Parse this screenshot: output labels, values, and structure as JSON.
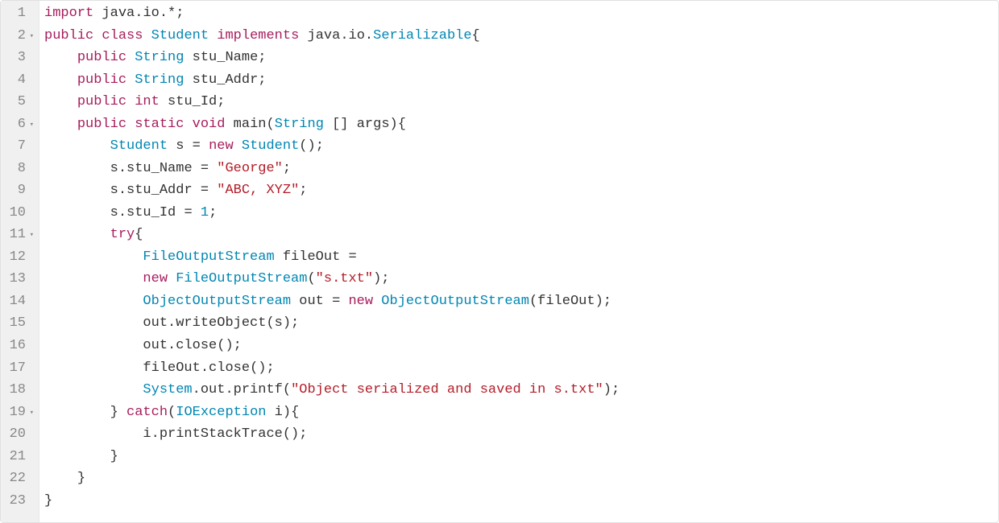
{
  "editor": {
    "language": "java",
    "fold_marker": "▾",
    "lines": [
      {
        "num": 1,
        "foldable": false,
        "tokens": [
          {
            "t": "import",
            "c": "kw"
          },
          {
            "t": " ",
            "c": "ws"
          },
          {
            "t": "java",
            "c": "pkg"
          },
          {
            "t": ".",
            "c": "punc"
          },
          {
            "t": "io",
            "c": "pkg"
          },
          {
            "t": ".*;",
            "c": "punc"
          }
        ]
      },
      {
        "num": 2,
        "foldable": true,
        "tokens": [
          {
            "t": "public",
            "c": "kw"
          },
          {
            "t": " ",
            "c": "ws"
          },
          {
            "t": "class",
            "c": "kw"
          },
          {
            "t": " ",
            "c": "ws"
          },
          {
            "t": "Student",
            "c": "type"
          },
          {
            "t": " ",
            "c": "ws"
          },
          {
            "t": "implements",
            "c": "kw"
          },
          {
            "t": " ",
            "c": "ws"
          },
          {
            "t": "java",
            "c": "pkg"
          },
          {
            "t": ".",
            "c": "punc"
          },
          {
            "t": "io",
            "c": "pkg"
          },
          {
            "t": ".",
            "c": "punc"
          },
          {
            "t": "Serializable",
            "c": "type"
          },
          {
            "t": "{",
            "c": "punc"
          }
        ]
      },
      {
        "num": 3,
        "foldable": false,
        "tokens": [
          {
            "t": "    ",
            "c": "ws"
          },
          {
            "t": "public",
            "c": "kw"
          },
          {
            "t": " ",
            "c": "ws"
          },
          {
            "t": "String",
            "c": "type"
          },
          {
            "t": " ",
            "c": "ws"
          },
          {
            "t": "stu_Name",
            "c": "ident"
          },
          {
            "t": ";",
            "c": "punc"
          }
        ]
      },
      {
        "num": 4,
        "foldable": false,
        "tokens": [
          {
            "t": "    ",
            "c": "ws"
          },
          {
            "t": "public",
            "c": "kw"
          },
          {
            "t": " ",
            "c": "ws"
          },
          {
            "t": "String",
            "c": "type"
          },
          {
            "t": " ",
            "c": "ws"
          },
          {
            "t": "stu_Addr",
            "c": "ident"
          },
          {
            "t": ";",
            "c": "punc"
          }
        ]
      },
      {
        "num": 5,
        "foldable": false,
        "tokens": [
          {
            "t": "    ",
            "c": "ws"
          },
          {
            "t": "public",
            "c": "kw"
          },
          {
            "t": " ",
            "c": "ws"
          },
          {
            "t": "int",
            "c": "kw"
          },
          {
            "t": " ",
            "c": "ws"
          },
          {
            "t": "stu_Id",
            "c": "ident"
          },
          {
            "t": ";",
            "c": "punc"
          }
        ]
      },
      {
        "num": 6,
        "foldable": true,
        "tokens": [
          {
            "t": "    ",
            "c": "ws"
          },
          {
            "t": "public",
            "c": "kw"
          },
          {
            "t": " ",
            "c": "ws"
          },
          {
            "t": "static",
            "c": "kw"
          },
          {
            "t": " ",
            "c": "ws"
          },
          {
            "t": "void",
            "c": "kw"
          },
          {
            "t": " ",
            "c": "ws"
          },
          {
            "t": "main",
            "c": "meth"
          },
          {
            "t": "(",
            "c": "punc"
          },
          {
            "t": "String",
            "c": "type"
          },
          {
            "t": " [] ",
            "c": "punc"
          },
          {
            "t": "args",
            "c": "ident"
          },
          {
            "t": "){",
            "c": "punc"
          }
        ]
      },
      {
        "num": 7,
        "foldable": false,
        "tokens": [
          {
            "t": "        ",
            "c": "ws"
          },
          {
            "t": "Student",
            "c": "type"
          },
          {
            "t": " ",
            "c": "ws"
          },
          {
            "t": "s",
            "c": "ident"
          },
          {
            "t": " = ",
            "c": "punc"
          },
          {
            "t": "new",
            "c": "kw"
          },
          {
            "t": " ",
            "c": "ws"
          },
          {
            "t": "Student",
            "c": "type"
          },
          {
            "t": "();",
            "c": "punc"
          }
        ]
      },
      {
        "num": 8,
        "foldable": false,
        "tokens": [
          {
            "t": "        ",
            "c": "ws"
          },
          {
            "t": "s",
            "c": "ident"
          },
          {
            "t": ".",
            "c": "punc"
          },
          {
            "t": "stu_Name",
            "c": "ident"
          },
          {
            "t": " = ",
            "c": "punc"
          },
          {
            "t": "\"George\"",
            "c": "str"
          },
          {
            "t": ";",
            "c": "punc"
          }
        ]
      },
      {
        "num": 9,
        "foldable": false,
        "tokens": [
          {
            "t": "        ",
            "c": "ws"
          },
          {
            "t": "s",
            "c": "ident"
          },
          {
            "t": ".",
            "c": "punc"
          },
          {
            "t": "stu_Addr",
            "c": "ident"
          },
          {
            "t": " = ",
            "c": "punc"
          },
          {
            "t": "\"ABC, XYZ\"",
            "c": "str"
          },
          {
            "t": ";",
            "c": "punc"
          }
        ]
      },
      {
        "num": 10,
        "foldable": false,
        "tokens": [
          {
            "t": "        ",
            "c": "ws"
          },
          {
            "t": "s",
            "c": "ident"
          },
          {
            "t": ".",
            "c": "punc"
          },
          {
            "t": "stu_Id",
            "c": "ident"
          },
          {
            "t": " = ",
            "c": "punc"
          },
          {
            "t": "1",
            "c": "num"
          },
          {
            "t": ";",
            "c": "punc"
          }
        ]
      },
      {
        "num": 11,
        "foldable": true,
        "tokens": [
          {
            "t": "        ",
            "c": "ws"
          },
          {
            "t": "try",
            "c": "kw"
          },
          {
            "t": "{",
            "c": "punc"
          }
        ]
      },
      {
        "num": 12,
        "foldable": false,
        "tokens": [
          {
            "t": "            ",
            "c": "ws"
          },
          {
            "t": "FileOutputStream",
            "c": "type"
          },
          {
            "t": " ",
            "c": "ws"
          },
          {
            "t": "fileOut",
            "c": "ident"
          },
          {
            "t": " =",
            "c": "punc"
          }
        ]
      },
      {
        "num": 13,
        "foldable": false,
        "tokens": [
          {
            "t": "            ",
            "c": "ws"
          },
          {
            "t": "new",
            "c": "kw"
          },
          {
            "t": " ",
            "c": "ws"
          },
          {
            "t": "FileOutputStream",
            "c": "type"
          },
          {
            "t": "(",
            "c": "punc"
          },
          {
            "t": "\"s.txt\"",
            "c": "str"
          },
          {
            "t": ");",
            "c": "punc"
          }
        ]
      },
      {
        "num": 14,
        "foldable": false,
        "tokens": [
          {
            "t": "            ",
            "c": "ws"
          },
          {
            "t": "ObjectOutputStream",
            "c": "type"
          },
          {
            "t": " ",
            "c": "ws"
          },
          {
            "t": "out",
            "c": "ident"
          },
          {
            "t": " = ",
            "c": "punc"
          },
          {
            "t": "new",
            "c": "kw"
          },
          {
            "t": " ",
            "c": "ws"
          },
          {
            "t": "ObjectOutputStream",
            "c": "type"
          },
          {
            "t": "(",
            "c": "punc"
          },
          {
            "t": "fileOut",
            "c": "ident"
          },
          {
            "t": ");",
            "c": "punc"
          }
        ]
      },
      {
        "num": 15,
        "foldable": false,
        "tokens": [
          {
            "t": "            ",
            "c": "ws"
          },
          {
            "t": "out",
            "c": "ident"
          },
          {
            "t": ".",
            "c": "punc"
          },
          {
            "t": "writeObject",
            "c": "meth"
          },
          {
            "t": "(",
            "c": "punc"
          },
          {
            "t": "s",
            "c": "ident"
          },
          {
            "t": ");",
            "c": "punc"
          }
        ]
      },
      {
        "num": 16,
        "foldable": false,
        "tokens": [
          {
            "t": "            ",
            "c": "ws"
          },
          {
            "t": "out",
            "c": "ident"
          },
          {
            "t": ".",
            "c": "punc"
          },
          {
            "t": "close",
            "c": "meth"
          },
          {
            "t": "();",
            "c": "punc"
          }
        ]
      },
      {
        "num": 17,
        "foldable": false,
        "tokens": [
          {
            "t": "            ",
            "c": "ws"
          },
          {
            "t": "fileOut",
            "c": "ident"
          },
          {
            "t": ".",
            "c": "punc"
          },
          {
            "t": "close",
            "c": "meth"
          },
          {
            "t": "();",
            "c": "punc"
          }
        ]
      },
      {
        "num": 18,
        "foldable": false,
        "tokens": [
          {
            "t": "            ",
            "c": "ws"
          },
          {
            "t": "System",
            "c": "type"
          },
          {
            "t": ".",
            "c": "punc"
          },
          {
            "t": "out",
            "c": "ident"
          },
          {
            "t": ".",
            "c": "punc"
          },
          {
            "t": "printf",
            "c": "meth"
          },
          {
            "t": "(",
            "c": "punc"
          },
          {
            "t": "\"Object serialized and saved in s.txt\"",
            "c": "str"
          },
          {
            "t": ");",
            "c": "punc"
          }
        ]
      },
      {
        "num": 19,
        "foldable": true,
        "tokens": [
          {
            "t": "        ",
            "c": "ws"
          },
          {
            "t": "} ",
            "c": "punc"
          },
          {
            "t": "catch",
            "c": "kw"
          },
          {
            "t": "(",
            "c": "punc"
          },
          {
            "t": "IOException",
            "c": "type"
          },
          {
            "t": " ",
            "c": "ws"
          },
          {
            "t": "i",
            "c": "ident"
          },
          {
            "t": "){",
            "c": "punc"
          }
        ]
      },
      {
        "num": 20,
        "foldable": false,
        "tokens": [
          {
            "t": "            ",
            "c": "ws"
          },
          {
            "t": "i",
            "c": "ident"
          },
          {
            "t": ".",
            "c": "punc"
          },
          {
            "t": "printStackTrace",
            "c": "meth"
          },
          {
            "t": "();",
            "c": "punc"
          }
        ]
      },
      {
        "num": 21,
        "foldable": false,
        "tokens": [
          {
            "t": "        ",
            "c": "ws"
          },
          {
            "t": "}",
            "c": "punc"
          }
        ]
      },
      {
        "num": 22,
        "foldable": false,
        "tokens": [
          {
            "t": "    ",
            "c": "ws"
          },
          {
            "t": "}",
            "c": "punc"
          }
        ]
      },
      {
        "num": 23,
        "foldable": false,
        "tokens": [
          {
            "t": "}",
            "c": "punc"
          }
        ]
      }
    ]
  }
}
